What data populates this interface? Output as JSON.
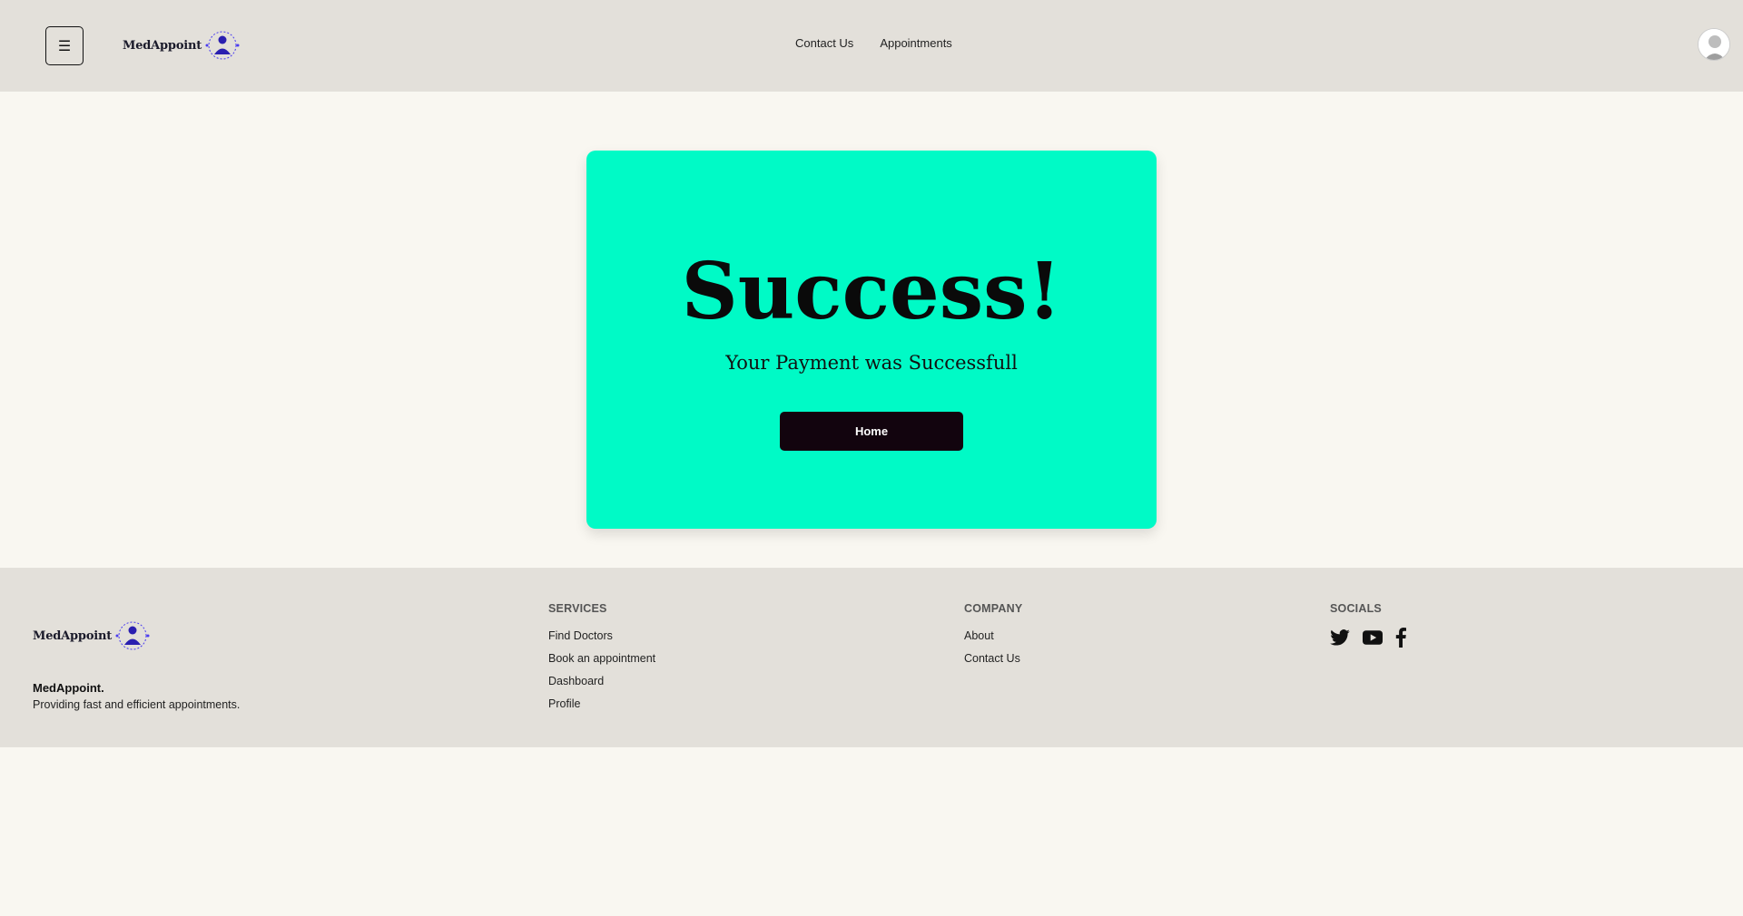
{
  "header": {
    "menu_label": "☰",
    "logo_text": "MedAppoint",
    "logo_ring_text": "MedAppoint",
    "nav": [
      "Contact Us",
      "Appointments"
    ]
  },
  "card": {
    "title": "Success!",
    "subtitle": "Your Payment was Successfull",
    "button": "Home",
    "background": "#00fac6"
  },
  "footer": {
    "logo_text": "MedAppoint",
    "brand": "MedAppoint.",
    "tagline": "Providing fast and efficient appointments.",
    "services": {
      "heading": "SERVICES",
      "links": [
        "Find Doctors",
        "Book an appointment",
        "Dashboard",
        "Profile"
      ]
    },
    "company": {
      "heading": "COMPANY",
      "links": [
        "About",
        "Contact Us"
      ]
    },
    "socials": {
      "heading": "SOCIALS",
      "icons": [
        "twitter-icon",
        "youtube-icon",
        "facebook-icon"
      ]
    }
  }
}
